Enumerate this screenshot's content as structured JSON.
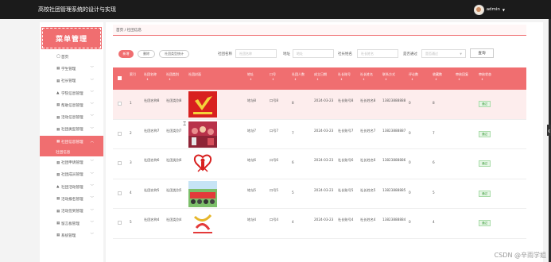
{
  "app": {
    "title": "高校社团管理系统的设计与实现",
    "user": "admin"
  },
  "sidebar": {
    "menu_title": "菜单管理",
    "items": [
      {
        "label": "首页",
        "icon": "home-icon",
        "glyph": "◯",
        "chevron": false
      },
      {
        "label": "学生管理",
        "icon": "grid-icon",
        "glyph": "▦",
        "chevron": true
      },
      {
        "label": "社长管理",
        "icon": "grid-icon",
        "glyph": "▦",
        "chevron": true
      },
      {
        "label": "学院信息管理",
        "icon": "person-icon",
        "glyph": "▲",
        "chevron": true
      },
      {
        "label": "帮助信息管理",
        "icon": "grid-icon",
        "glyph": "▦",
        "chevron": true
      },
      {
        "label": "活动信息管理",
        "icon": "grid-icon",
        "glyph": "▦",
        "chevron": true
      },
      {
        "label": "社团类型管理",
        "icon": "grid-icon",
        "glyph": "▦",
        "chevron": true
      },
      {
        "label": "社团信息管理",
        "icon": "grid-icon",
        "glyph": "▦",
        "chevron": true,
        "active": true
      },
      {
        "label": "社团信息",
        "sub": true
      },
      {
        "label": "社团申请管理",
        "icon": "grid-icon",
        "glyph": "▦",
        "chevron": true
      },
      {
        "label": "社团成员管理",
        "icon": "grid-icon",
        "glyph": "▦",
        "chevron": true
      },
      {
        "label": "社团活动管理",
        "icon": "person-icon",
        "glyph": "▲",
        "chevron": true
      },
      {
        "label": "活动报名管理",
        "icon": "grid-icon",
        "glyph": "▦",
        "chevron": true
      },
      {
        "label": "活动签到管理",
        "icon": "grid-icon",
        "glyph": "▦",
        "chevron": true
      },
      {
        "label": "留言板管理",
        "icon": "grid-icon",
        "glyph": "▦",
        "chevron": true
      },
      {
        "label": "系统管理",
        "icon": "grid-icon",
        "glyph": "▦",
        "chevron": true
      }
    ]
  },
  "breadcrumb": "首页 / 社团信息",
  "toolbar": {
    "add": "新增",
    "delete": "删除",
    "report": "社团类型统计"
  },
  "filters": {
    "name_label": "社团名称",
    "name_placeholder": "社团名称",
    "address_label": "地址",
    "address_placeholder": "地址",
    "leader_label": "社长姓名",
    "leader_placeholder": "社长姓名",
    "approved_label": "是否通过",
    "approved_placeholder": "是否通过",
    "search": "查询"
  },
  "table": {
    "headers": [
      "索引",
      "社团名称",
      "社团类别",
      "社团封面",
      "地址",
      "口号",
      "社团人数",
      "成立日期",
      "社长账号",
      "社长姓名",
      "联系方式",
      "评论数",
      "收藏数",
      "审核回复",
      "审核状态"
    ],
    "sort_glyph": "⇕",
    "rows": [
      {
        "idx": "1",
        "name": "社团名称8",
        "type": "社团类别8",
        "addr": "地址8",
        "slogan": "口号8",
        "members": "8",
        "date": "2024-03-23",
        "account": "社长账号8",
        "leader": "社长姓名8",
        "phone": "13823888888",
        "comments": "0",
        "favs": "8",
        "reply": "",
        "status": "通过"
      },
      {
        "idx": "2",
        "name": "社团名称7",
        "type": "社团类别7",
        "addr": "地址7",
        "slogan": "口号7",
        "members": "7",
        "date": "2024-03-23",
        "account": "社长账号7",
        "leader": "社长姓名7",
        "phone": "13823888887",
        "comments": "0",
        "favs": "7",
        "reply": "",
        "status": "通过"
      },
      {
        "idx": "3",
        "name": "社团名称6",
        "type": "社团类别6",
        "addr": "地址6",
        "slogan": "口号6",
        "members": "6",
        "date": "2024-03-23",
        "account": "社长账号6",
        "leader": "社长姓名6",
        "phone": "13823888886",
        "comments": "0",
        "favs": "6",
        "reply": "",
        "status": "通过"
      },
      {
        "idx": "4",
        "name": "社团名称5",
        "type": "社团类别5",
        "addr": "地址5",
        "slogan": "口号5",
        "members": "5",
        "date": "2024-03-23",
        "account": "社长账号5",
        "leader": "社长姓名5",
        "phone": "13823888885",
        "comments": "0",
        "favs": "5",
        "reply": "",
        "status": "通过"
      },
      {
        "idx": "5",
        "name": "社团名称4",
        "type": "社团类别4",
        "addr": "地址4",
        "slogan": "口号4",
        "members": "4",
        "date": "2024-03-23",
        "account": "社长账号4",
        "leader": "社长姓名4",
        "phone": "13823888884",
        "comments": "0",
        "favs": "4",
        "reply": "",
        "status": "通过"
      }
    ]
  },
  "watermark": "CSDN @辛雨学姐",
  "colors": {
    "accent": "#f06e70",
    "topbar": "#1b1b1b",
    "approved_text": "#3a9b3a"
  }
}
